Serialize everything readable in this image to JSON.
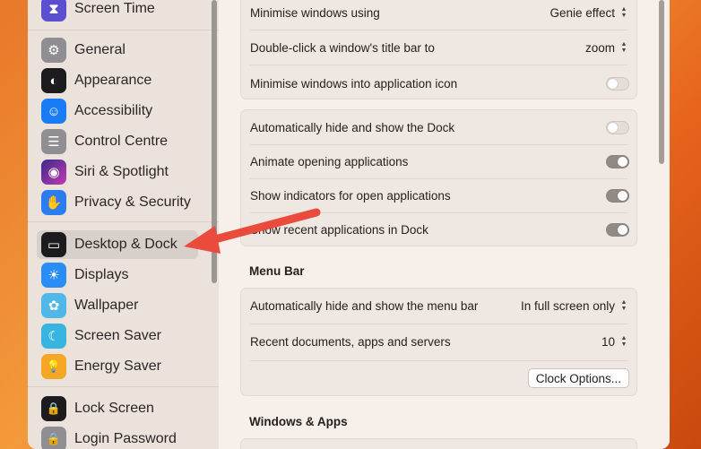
{
  "sidebar": {
    "items": [
      {
        "label": "Screen Time",
        "icon": "hourglass-icon",
        "color": "#5b4fcf",
        "glyph": "⧗"
      },
      {
        "label": "General",
        "icon": "gear-icon",
        "color": "#8e8e93",
        "glyph": "⚙"
      },
      {
        "label": "Appearance",
        "icon": "appearance-icon",
        "color": "#1c1c1e",
        "glyph": "◐"
      },
      {
        "label": "Accessibility",
        "icon": "accessibility-icon",
        "color": "#1a7cf5",
        "glyph": "☺"
      },
      {
        "label": "Control Centre",
        "icon": "toggles-icon",
        "color": "#8e8e93",
        "glyph": "☰"
      },
      {
        "label": "Siri & Spotlight",
        "icon": "siri-icon",
        "color": "#7a3fd1",
        "glyph": "◉"
      },
      {
        "label": "Privacy & Security",
        "icon": "hand-icon",
        "color": "#2a7cf0",
        "glyph": "✋"
      },
      {
        "label": "Desktop & Dock",
        "icon": "dock-icon",
        "color": "#1c1c1e",
        "glyph": "▭"
      },
      {
        "label": "Displays",
        "icon": "sun-icon",
        "color": "#2a8cf5",
        "glyph": "☀"
      },
      {
        "label": "Wallpaper",
        "icon": "flower-icon",
        "color": "#4fb8e8",
        "glyph": "✿"
      },
      {
        "label": "Screen Saver",
        "icon": "moon-icon",
        "color": "#37b5e0",
        "glyph": "☾"
      },
      {
        "label": "Energy Saver",
        "icon": "bulb-icon",
        "color": "#f5a623",
        "glyph": "💡"
      },
      {
        "label": "Lock Screen",
        "icon": "lock-icon",
        "color": "#1c1c1e",
        "glyph": "🔒"
      },
      {
        "label": "Login Password",
        "icon": "lock-icon",
        "color": "#8e8e93",
        "glyph": "🔒"
      }
    ]
  },
  "window_group": {
    "minimise_label": "Minimise windows using",
    "minimise_value": "Genie effect",
    "double_click_label": "Double-click a window's title bar to",
    "double_click_value": "zoom",
    "minimise_into_icon_label": "Minimise windows into application icon"
  },
  "dock_group": {
    "auto_hide_label": "Automatically hide and show the Dock",
    "animate_label": "Animate opening applications",
    "indicators_label": "Show indicators for open applications",
    "recent_label": "Show recent applications in Dock"
  },
  "menu_bar": {
    "title": "Menu Bar",
    "auto_hide_label": "Automatically hide and show the menu bar",
    "auto_hide_value": "In full screen only",
    "recent_docs_label": "Recent documents, apps and servers",
    "recent_docs_value": "10",
    "clock_button": "Clock Options..."
  },
  "windows_apps": {
    "title": "Windows & Apps"
  },
  "colors": {
    "arrow": "#ea4b3c",
    "selected": "#d7cfc9"
  }
}
